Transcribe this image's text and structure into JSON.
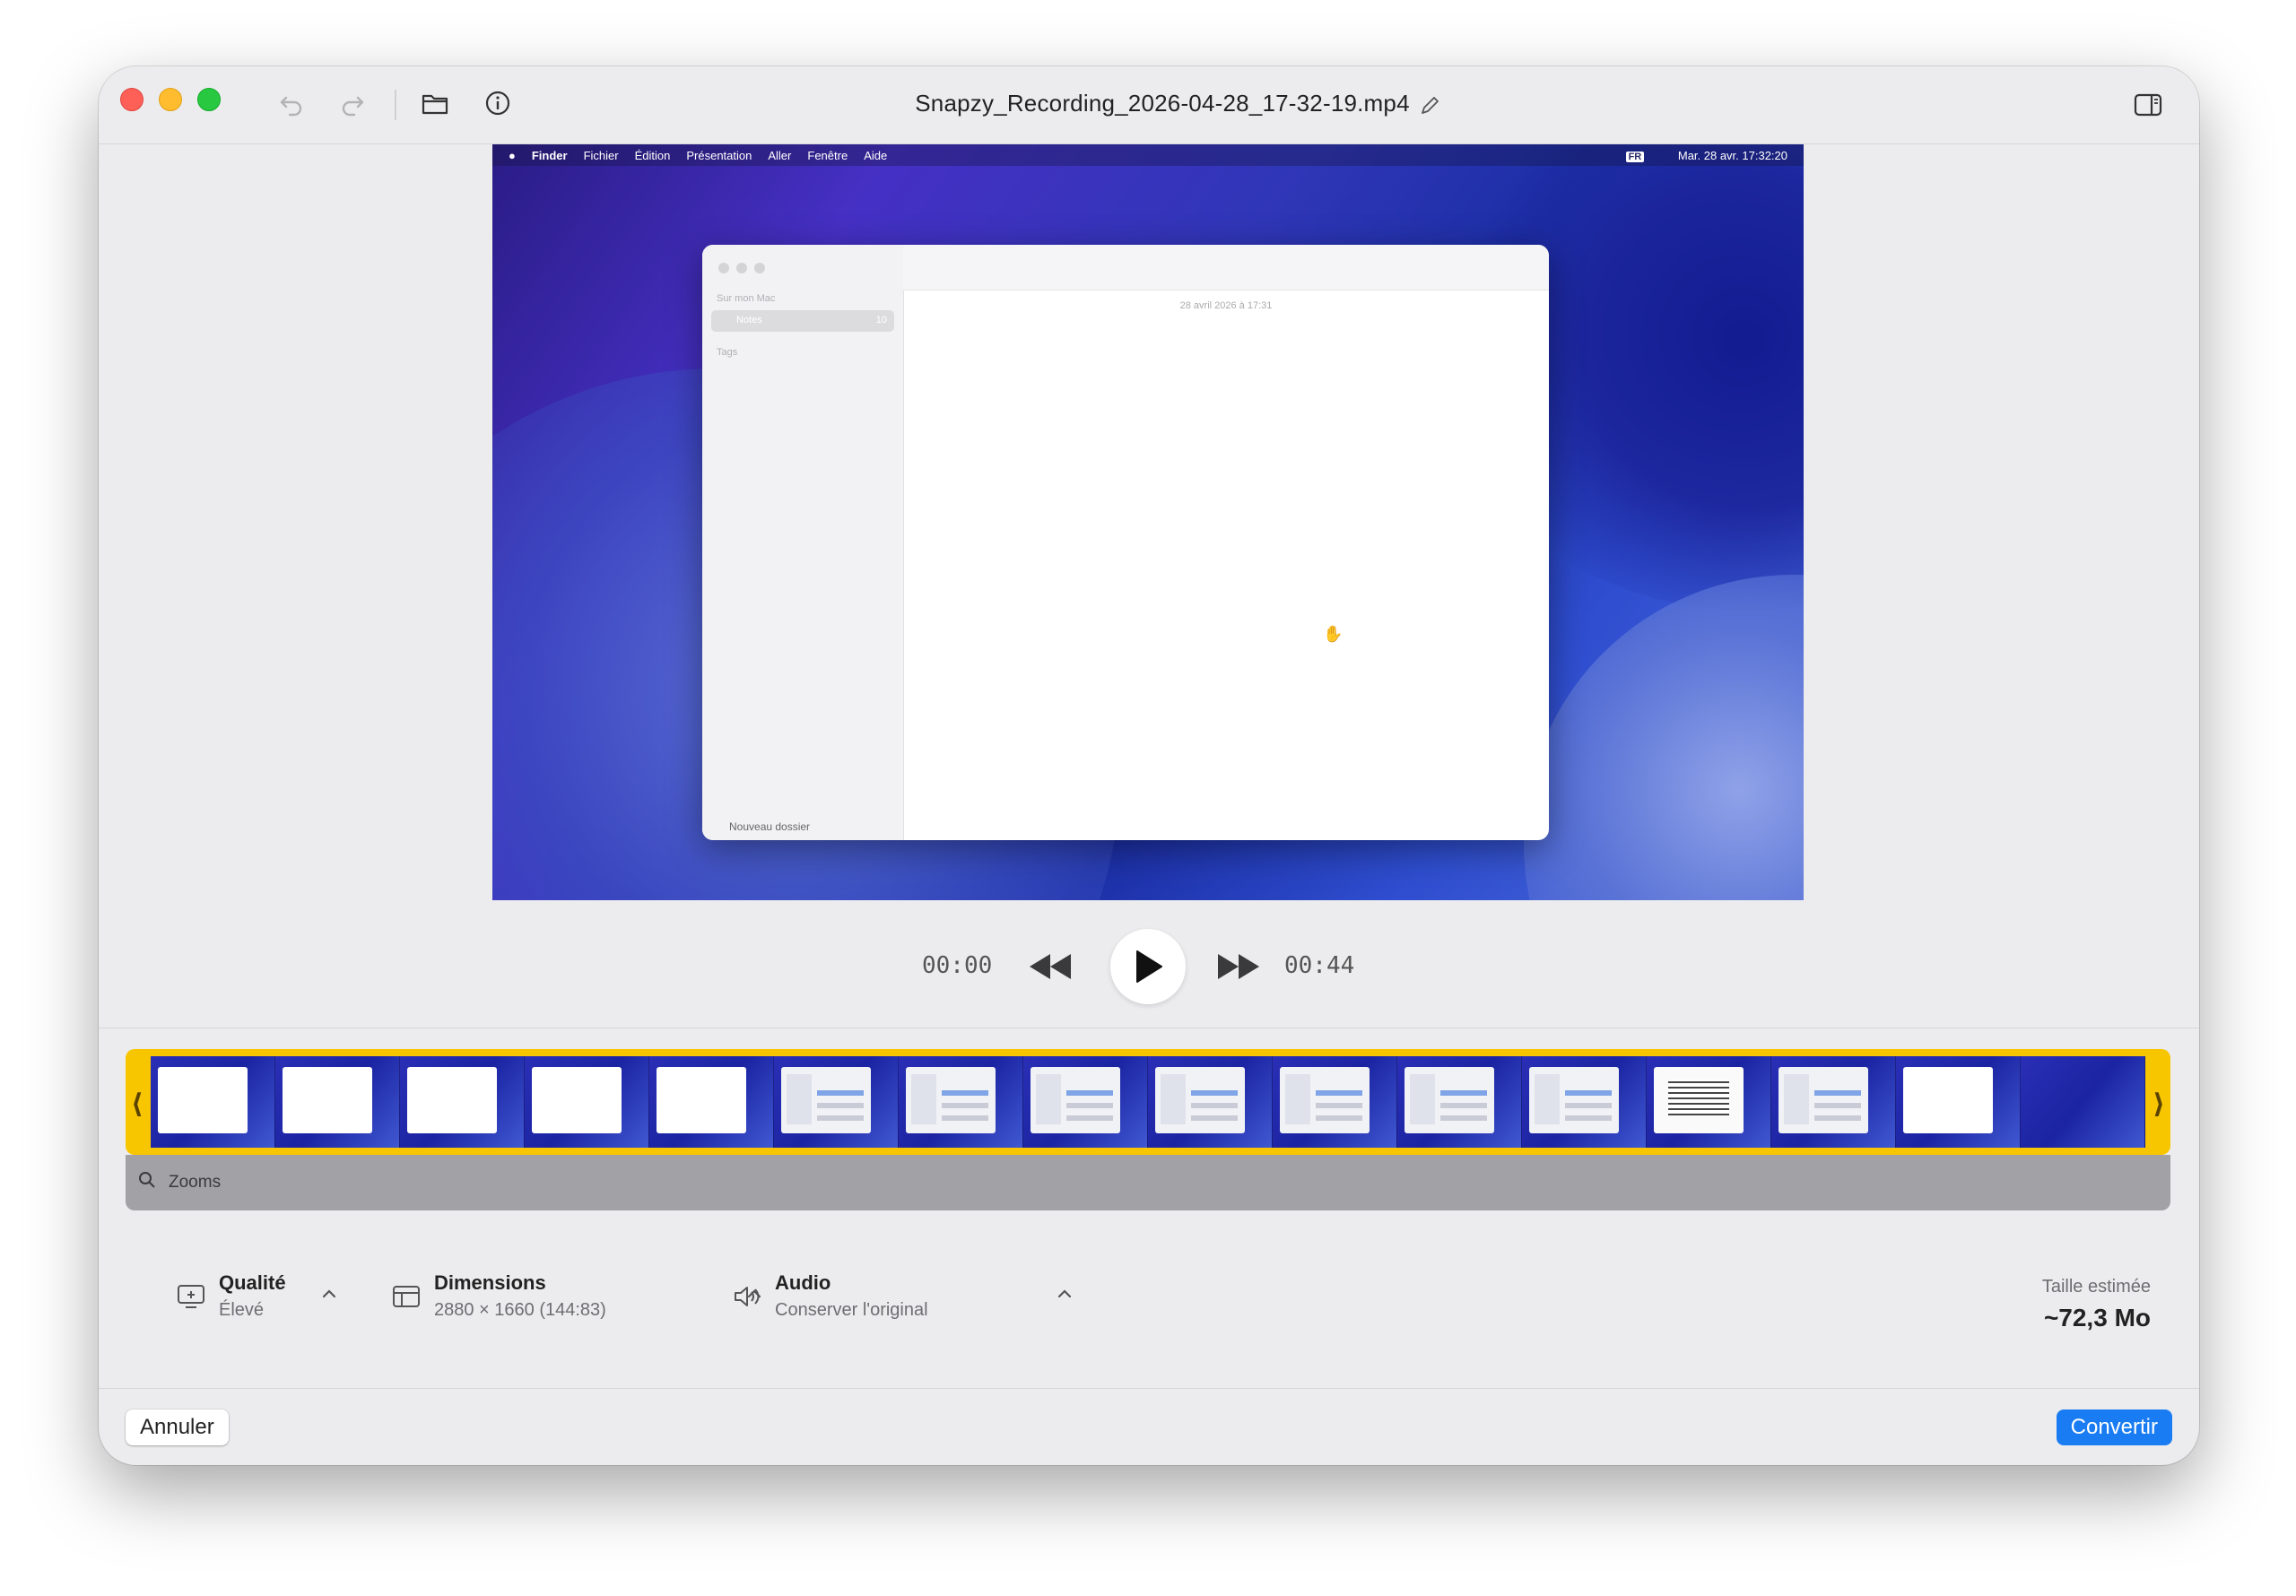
{
  "window": {
    "title": "Snapzy_Recording_2026-04-28_17-32-19.mp4"
  },
  "video_content": {
    "menubar": {
      "items": [
        "Finder",
        "Fichier",
        "Édition",
        "Présentation",
        "Aller",
        "Fenêtre",
        "Aide"
      ],
      "status_lang": "FR",
      "clock": "Mar. 28 avr.  17:32:20"
    },
    "notes_app": {
      "section": "Sur mon Mac",
      "folder": "Notes",
      "folder_count": "10",
      "tags": "Tags",
      "new_folder": "Nouveau dossier",
      "note_date": "28 avril 2026 à 17:31"
    }
  },
  "playback": {
    "current_time": "00:00",
    "total_time": "00:44"
  },
  "timeline": {
    "thumbnails": [
      "blank",
      "blank",
      "blank",
      "blank",
      "blank",
      "ui",
      "ui",
      "ui",
      "ui",
      "ui",
      "ui",
      "ui",
      "doc",
      "ui",
      "blank",
      "wave"
    ],
    "zooms_label": "Zooms"
  },
  "settings": {
    "quality": {
      "label": "Qualité",
      "value": "Élevé"
    },
    "dimensions": {
      "label": "Dimensions",
      "value": "2880 × 1660 (144:83)"
    },
    "audio": {
      "label": "Audio",
      "value": "Conserver l'original"
    }
  },
  "estimate": {
    "label": "Taille estimée",
    "value": "~72,3 Mo"
  },
  "actions": {
    "cancel": "Annuler",
    "convert": "Convertir"
  },
  "colors": {
    "accent": "#1a7cf2",
    "timeline_border": "#f7c600"
  }
}
